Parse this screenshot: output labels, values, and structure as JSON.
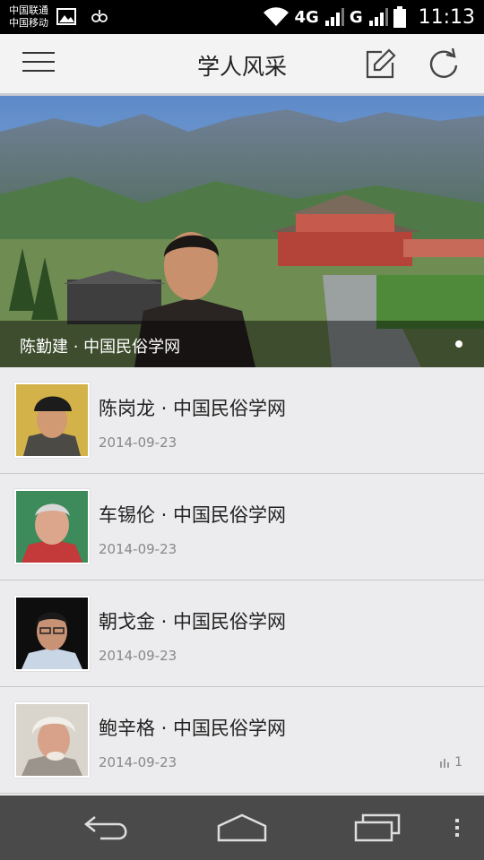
{
  "status_bar": {
    "carrier_1": "中国联通",
    "carrier_2": "中国移动",
    "net_1": "4G",
    "net_1_sub": "LTE",
    "net_2": "G",
    "time": "11:13"
  },
  "header": {
    "title": "学人风采"
  },
  "hero": {
    "caption": "陈勤建 · 中国民俗学网"
  },
  "articles": [
    {
      "title": "陈岗龙 · 中国民俗学网",
      "date": "2014-09-23",
      "views": ""
    },
    {
      "title": "车锡伦 · 中国民俗学网",
      "date": "2014-09-23",
      "views": ""
    },
    {
      "title": "朝戈金 · 中国民俗学网",
      "date": "2014-09-23",
      "views": ""
    },
    {
      "title": "鲍辛格 · 中国民俗学网",
      "date": "2014-09-23",
      "views": "1"
    }
  ]
}
